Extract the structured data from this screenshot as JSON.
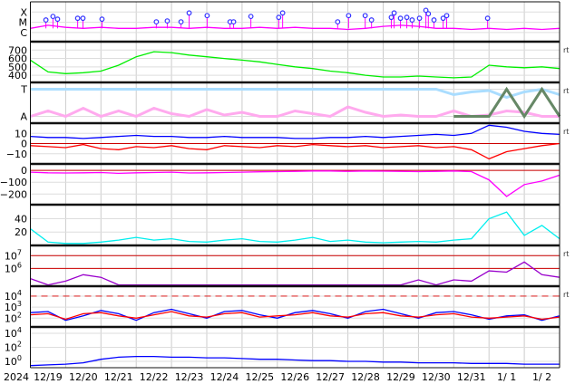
{
  "chart_data": {
    "type": "line",
    "title": "",
    "x_unit": "days since 2024-12-19 00:00 UT",
    "xlim": [
      0,
      15
    ],
    "x_tick_labels": [
      "2024",
      "12/19",
      "12/20",
      "12/21",
      "12/22",
      "12/23",
      "12/24",
      "12/25",
      "12/26",
      "12/27",
      "12/28",
      "12/29",
      "12/30",
      "12/31",
      "1/ 1",
      "1/ 2"
    ],
    "t": [
      0,
      0.5,
      1,
      1.5,
      2,
      2.5,
      3,
      3.5,
      4,
      4.5,
      5,
      5.5,
      6,
      6.5,
      7,
      7.5,
      8,
      8.5,
      9,
      9.5,
      10,
      10.5,
      11,
      11.5,
      12,
      12.5,
      13,
      13.5,
      14,
      14.5,
      15
    ],
    "panels": [
      {
        "id": "xray",
        "scale": "log",
        "ylim": [
          -6.9,
          -3.0
        ],
        "ticks": [
          {
            "v": -6,
            "label": "C"
          },
          {
            "v": -5,
            "label": "M"
          },
          {
            "v": -4,
            "label": "X"
          }
        ],
        "rt": "",
        "series": [
          {
            "name": "X-ray flux",
            "color": "#ff00ff",
            "values": [
              -5.6,
              -5.3,
              -5.5,
              -5.6,
              -5.5,
              -5.6,
              -5.6,
              -5.5,
              -5.5,
              -5.6,
              -5.5,
              -5.6,
              -5.6,
              -5.5,
              -5.6,
              -5.5,
              -5.6,
              -5.6,
              -5.7,
              -5.6,
              -5.4,
              -5.3,
              -5.4,
              -5.6,
              -5.6,
              -5.7,
              -5.6,
              -5.7,
              -5.6,
              -5.7,
              -5.6
            ]
          }
        ],
        "flares": [
          [
            0.44,
            -4.78
          ],
          [
            0.64,
            -4.43
          ],
          [
            0.77,
            -4.7
          ],
          [
            1.34,
            -4.61
          ],
          [
            1.49,
            -4.61
          ],
          [
            2.03,
            -4.7
          ],
          [
            3.57,
            -4.96
          ],
          [
            3.88,
            -4.87
          ],
          [
            4.27,
            -4.96
          ],
          [
            4.5,
            -4.09
          ],
          [
            5.01,
            -4.35
          ],
          [
            5.66,
            -4.96
          ],
          [
            5.76,
            -4.96
          ],
          [
            6.25,
            -4.43
          ],
          [
            7.04,
            -4.52
          ],
          [
            7.15,
            -4.09
          ],
          [
            8.71,
            -4.96
          ],
          [
            9.02,
            -4.35
          ],
          [
            9.49,
            -4.35
          ],
          [
            9.67,
            -4.78
          ],
          [
            10.23,
            -4.52
          ],
          [
            10.31,
            -4.09
          ],
          [
            10.49,
            -4.61
          ],
          [
            10.67,
            -4.52
          ],
          [
            10.82,
            -4.78
          ],
          [
            11.03,
            -4.61
          ],
          [
            11.21,
            -3.83
          ],
          [
            11.28,
            -4.17
          ],
          [
            11.44,
            -4.78
          ],
          [
            11.7,
            -4.61
          ],
          [
            11.8,
            -4.35
          ],
          [
            12.96,
            -4.61
          ]
        ]
      },
      {
        "id": "speed",
        "scale": "linear",
        "ylim": [
          315,
          800
        ],
        "ticks": [
          {
            "v": 400,
            "label": "400"
          },
          {
            "v": 500,
            "label": "500"
          },
          {
            "v": 600,
            "label": "600"
          },
          {
            "v": 700,
            "label": "700"
          }
        ],
        "rt": "rt",
        "series": [
          {
            "name": "Solar wind speed",
            "color": "#00ee00",
            "values": [
              580,
              440,
              420,
              430,
              450,
              520,
              620,
              680,
              670,
              640,
              620,
              600,
              580,
              560,
              530,
              500,
              480,
              450,
              430,
              400,
              380,
              380,
              390,
              380,
              370,
              380,
              520,
              500,
              490,
              500,
              480
            ]
          }
        ]
      },
      {
        "id": "imf-sector",
        "scale": "linear",
        "ylim": [
          -1.5,
          1.5
        ],
        "ticks": [
          {
            "v": 1,
            "label": "T"
          },
          {
            "v": -1,
            "label": "A"
          }
        ],
        "rt": "rt",
        "series": [
          {
            "name": "Toward",
            "color": "#aaddff",
            "values": [
              1,
              1,
              1,
              1,
              1,
              1,
              1,
              1,
              1,
              1,
              1,
              1,
              1,
              1,
              1,
              1,
              1,
              1,
              1,
              1,
              1,
              1,
              1,
              1,
              0.6,
              0.8,
              0.9,
              0.4,
              0.8,
              1,
              0.6
            ]
          },
          {
            "name": "Away",
            "color": "#ffaaee",
            "values": [
              -1,
              -0.6,
              -1,
              -0.4,
              -1,
              -0.6,
              -1,
              -0.4,
              -0.8,
              -1,
              -0.5,
              -0.9,
              -0.7,
              -1,
              -1,
              -0.6,
              -0.8,
              -1,
              -0.3,
              -0.7,
              -1,
              -0.9,
              -1,
              -1,
              -0.6,
              -1,
              -0.9,
              -0.6,
              -0.7,
              -1,
              -1
            ]
          },
          {
            "name": "rt sector",
            "color": "#668866",
            "values": [
              null,
              null,
              null,
              null,
              null,
              null,
              null,
              null,
              null,
              null,
              null,
              null,
              null,
              null,
              null,
              null,
              null,
              null,
              null,
              null,
              null,
              null,
              null,
              null,
              -1,
              -1,
              -1,
              1,
              -1,
              1,
              -1
            ]
          }
        ]
      },
      {
        "id": "imf",
        "scale": "linear",
        "ylim": [
          -20,
          20
        ],
        "ticks": [
          {
            "v": 10,
            "label": "10"
          },
          {
            "v": 0,
            "label": "0"
          },
          {
            "v": -10,
            "label": "−10"
          }
        ],
        "rt": "rt",
        "zero_line": 0,
        "series": [
          {
            "name": "Bt",
            "color": "#0000ff",
            "values": [
              7,
              6,
              6,
              5,
              6,
              7,
              8,
              7,
              7,
              6,
              6,
              7,
              6,
              6,
              6,
              5,
              5,
              6,
              6,
              7,
              6,
              7,
              8,
              9,
              8,
              10,
              18,
              16,
              12,
              10,
              9
            ]
          },
          {
            "name": "Bz",
            "color": "#ff0000",
            "values": [
              -2,
              -3,
              -4,
              -1,
              -5,
              -6,
              -3,
              -4,
              -2,
              -5,
              -6,
              -2,
              -3,
              -4,
              -2,
              -3,
              -1,
              -2,
              -3,
              -2,
              -4,
              -3,
              -2,
              -4,
              -3,
              -6,
              -15,
              -8,
              -5,
              -2,
              0
            ]
          }
        ]
      },
      {
        "id": "dst",
        "scale": "linear",
        "ylim": [
          -290,
          55
        ],
        "ticks": [
          {
            "v": 0,
            "label": "0"
          },
          {
            "v": -100,
            "label": "−100"
          },
          {
            "v": -200,
            "label": "−200"
          }
        ],
        "rt": "",
        "zero_line": 0,
        "series": [
          {
            "name": "Dst",
            "color": "#ff00ff",
            "values": [
              -15,
              -20,
              -22,
              -20,
              -18,
              -25,
              -20,
              -18,
              -15,
              -22,
              -20,
              -18,
              -15,
              -12,
              -10,
              -8,
              -5,
              -5,
              -8,
              -5,
              -6,
              -8,
              -10,
              -8,
              -5,
              -10,
              -80,
              -220,
              -120,
              -90,
              -40
            ]
          }
        ]
      },
      {
        "id": "density",
        "scale": "linear",
        "ylim": [
          0,
          61
        ],
        "ticks": [
          {
            "v": 20,
            "label": "20"
          },
          {
            "v": 40,
            "label": "40"
          }
        ],
        "rt": "",
        "series": [
          {
            "name": "Density",
            "color": "#00eeee",
            "values": [
              25,
              5,
              3,
              3,
              5,
              8,
              12,
              8,
              10,
              6,
              5,
              8,
              10,
              6,
              5,
              8,
              12,
              6,
              8,
              5,
              4,
              5,
              6,
              5,
              8,
              10,
              40,
              50,
              15,
              30,
              10
            ]
          }
        ]
      },
      {
        "id": "proton",
        "scale": "log",
        "ylim": [
          4.6,
          7.8
        ],
        "ticks": [
          {
            "v": 6,
            "label": "10",
            "exp": "6"
          },
          {
            "v": 7,
            "label": "10",
            "exp": "7"
          }
        ],
        "rt": "rt",
        "ref_lines": [
          6,
          7
        ],
        "series": [
          {
            "name": "Proton flux",
            "color": "#9900cc",
            "values": [
              5.2,
              4.7,
              5.0,
              5.5,
              5.3,
              4.7,
              4.7,
              4.7,
              4.7,
              4.7,
              4.7,
              4.7,
              4.7,
              4.7,
              4.7,
              4.7,
              4.7,
              4.7,
              4.7,
              4.7,
              4.7,
              4.7,
              5.1,
              4.7,
              5.1,
              5.0,
              5.8,
              5.7,
              6.5,
              5.5,
              5.3
            ]
          }
        ]
      },
      {
        "id": "electron",
        "scale": "log",
        "ylim": [
          1.2,
          4.9
        ],
        "ticks": [
          {
            "v": 2,
            "label": "10",
            "exp": "2"
          },
          {
            "v": 3,
            "label": "10",
            "exp": "3"
          },
          {
            "v": 4,
            "label": "10",
            "exp": "4"
          }
        ],
        "rt": "rt",
        "dashed_line": 4,
        "series": [
          {
            "name": "Electron flux A",
            "color": "#0000ff",
            "values": [
              2.5,
              2.6,
              1.8,
              2.2,
              2.7,
              2.4,
              1.8,
              2.5,
              2.8,
              2.4,
              2.0,
              2.6,
              2.7,
              2.3,
              2.0,
              2.5,
              2.7,
              2.4,
              2.0,
              2.6,
              2.8,
              2.4,
              2.0,
              2.5,
              2.6,
              2.3,
              1.9,
              2.2,
              2.3,
              1.8,
              2.2
            ]
          },
          {
            "name": "Electron flux B",
            "color": "#ff0000",
            "values": [
              2.3,
              2.4,
              1.9,
              2.4,
              2.5,
              2.2,
              2.0,
              2.3,
              2.6,
              2.2,
              2.1,
              2.4,
              2.5,
              2.1,
              2.2,
              2.3,
              2.5,
              2.2,
              2.1,
              2.4,
              2.5,
              2.2,
              2.1,
              2.3,
              2.4,
              2.1,
              2.0,
              2.1,
              2.2,
              1.9,
              2.1
            ]
          }
        ]
      },
      {
        "id": "fluence",
        "scale": "log",
        "ylim": [
          -0.9,
          4.9
        ],
        "ticks": [
          {
            "v": 0,
            "label": "10",
            "exp": "0"
          },
          {
            "v": 2,
            "label": "10",
            "exp": "2"
          },
          {
            "v": 4,
            "label": "10",
            "exp": "4"
          }
        ],
        "rt": "",
        "series": [
          {
            "name": "Electron fluence",
            "color": "#0000ff",
            "values": [
              -0.6,
              -0.5,
              -0.4,
              -0.2,
              0.3,
              0.6,
              0.7,
              0.7,
              0.6,
              0.6,
              0.5,
              0.5,
              0.4,
              0.3,
              0.3,
              0.2,
              0.1,
              0.1,
              0,
              0,
              -0.1,
              -0.1,
              -0.2,
              -0.2,
              -0.2,
              -0.3,
              -0.3,
              -0.3,
              -0.4,
              -0.4,
              -0.4
            ]
          }
        ]
      }
    ]
  }
}
